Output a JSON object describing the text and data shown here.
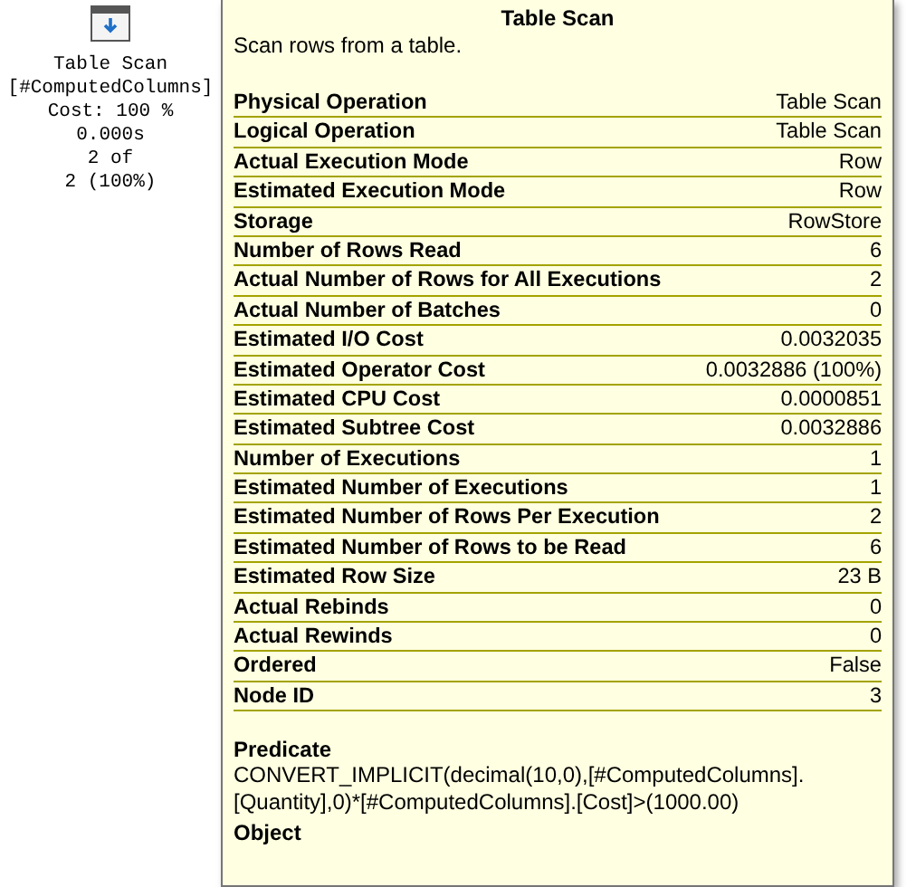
{
  "plan_node": {
    "title": "Table Scan",
    "object": "[#ComputedColumns]",
    "cost": "Cost: 100 %",
    "time": "0.000s",
    "rows_line_1": "2 of",
    "rows_line_2": "2 (100%)"
  },
  "tooltip": {
    "title": "Table Scan",
    "description": "Scan rows from a table.",
    "properties": [
      {
        "name": "Physical Operation",
        "value": "Table Scan"
      },
      {
        "name": "Logical Operation",
        "value": "Table Scan"
      },
      {
        "name": "Actual Execution Mode",
        "value": "Row"
      },
      {
        "name": "Estimated Execution Mode",
        "value": "Row"
      },
      {
        "name": "Storage",
        "value": "RowStore"
      },
      {
        "name": "Number of Rows Read",
        "value": "6"
      },
      {
        "name": "Actual Number of Rows for All Executions",
        "value": "2"
      },
      {
        "name": "Actual Number of Batches",
        "value": "0"
      },
      {
        "name": "Estimated I/O Cost",
        "value": "0.0032035"
      },
      {
        "name": "Estimated Operator Cost",
        "value": "0.0032886 (100%)"
      },
      {
        "name": "Estimated CPU Cost",
        "value": "0.0000851"
      },
      {
        "name": "Estimated Subtree Cost",
        "value": "0.0032886"
      },
      {
        "name": "Number of Executions",
        "value": "1"
      },
      {
        "name": "Estimated Number of Executions",
        "value": "1"
      },
      {
        "name": "Estimated Number of Rows Per Execution",
        "value": "2"
      },
      {
        "name": "Estimated Number of Rows to be Read",
        "value": "6"
      },
      {
        "name": "Estimated Row Size",
        "value": "23 B"
      },
      {
        "name": "Actual Rebinds",
        "value": "0"
      },
      {
        "name": "Actual Rewinds",
        "value": "0"
      },
      {
        "name": "Ordered",
        "value": "False"
      },
      {
        "name": "Node ID",
        "value": "3"
      }
    ],
    "sections": [
      {
        "heading": "Predicate",
        "lines": [
          "CONVERT_IMPLICIT(decimal(10,0),[#ComputedColumns].",
          "[Quantity],0)*[#ComputedColumns].[Cost]>(1000.00)"
        ]
      },
      {
        "heading": "Object"
      }
    ]
  }
}
